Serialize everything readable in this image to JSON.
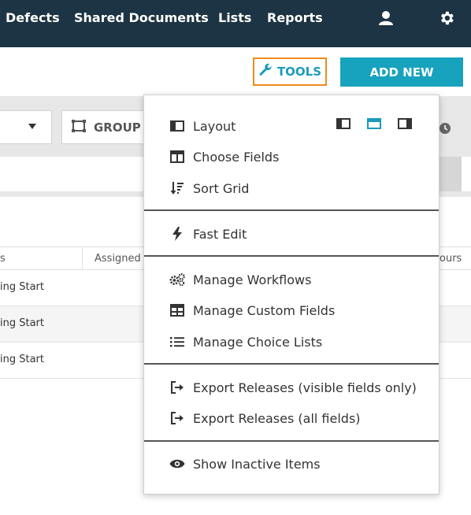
{
  "nav": {
    "items": [
      "Defects",
      "Shared Documents",
      "Lists",
      "Reports"
    ],
    "user_icon": "user-icon",
    "settings_icon": "gear-icon"
  },
  "toolbar": {
    "tools_label": "TOOLS",
    "add_new_label": "ADD NEW"
  },
  "filter": {
    "group_label": "GROUP"
  },
  "grid": {
    "columns": [
      "s",
      "Assigned",
      "ours"
    ],
    "rows": [
      {
        "status": "ing Start"
      },
      {
        "status": "ing Start"
      },
      {
        "status": "ing Start"
      }
    ]
  },
  "menu": {
    "layout_label": "Layout",
    "layout_options": [
      "left-panel",
      "top-panel",
      "right-panel"
    ],
    "layout_selected": "top-panel",
    "choose_fields": "Choose Fields",
    "sort_grid": "Sort Grid",
    "fast_edit": "Fast Edit",
    "manage_workflows": "Manage Workflows",
    "manage_custom_fields": "Manage Custom Fields",
    "manage_choice_lists": "Manage Choice Lists",
    "export_visible": "Export Releases (visible fields only)",
    "export_all": "Export Releases (all fields)",
    "show_inactive": "Show Inactive Items"
  },
  "colors": {
    "nav_bg": "#1c3443",
    "accent": "#17a2bd",
    "tools_border": "#ef8b1d"
  }
}
